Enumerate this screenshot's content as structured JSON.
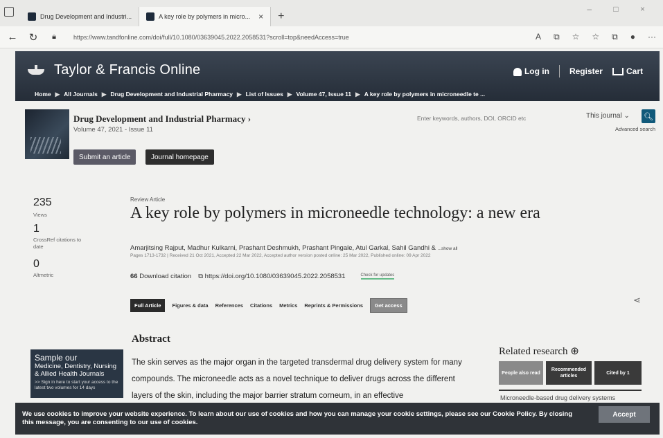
{
  "browser": {
    "tabs": [
      {
        "label": "Drug Development and Industri..."
      },
      {
        "label": "A key role by polymers in micro..."
      }
    ],
    "url": "https://www.tandfonline.com/doi/full/10.1080/03639045.2022.2058531?scroll=top&needAccess=true"
  },
  "header": {
    "logo": "Taylor & Francis Online",
    "login": "Log in",
    "register": "Register",
    "cart": "Cart"
  },
  "breadcrumb": [
    "Home",
    "All Journals",
    "Drug Development and Industrial Pharmacy",
    "List of Issues",
    "Volume 47, Issue 11",
    "A key role by polymers in microneedle te ..."
  ],
  "journal": {
    "title": "Drug Development and Industrial Pharmacy",
    "volume": "Volume 47, 2021 - Issue 11",
    "submit": "Submit an article",
    "homepage": "Journal homepage",
    "search_placeholder": "Enter keywords, authors, DOI, ORCID etc",
    "scope": "This journal",
    "advanced": "Advanced search"
  },
  "metrics": {
    "views": "235",
    "views_label": "Views",
    "crossref": "1",
    "crossref_label": "CrossRef citations to date",
    "altmetric": "0",
    "altmetric_label": "Altmetric"
  },
  "article": {
    "kind": "Review Article",
    "title": "A key role by polymers in microneedle technology: a new era",
    "authors": "Amarjitsing Rajput, Madhur Kulkarni, Prashant Deshmukh, Prashant Pingale, Atul Garkal, Sahil Gandhi &",
    "show_all": "...show all",
    "pubinfo": "Pages 1713-1732 | Received 21 Oct 2021, Accepted 22 Mar 2022, Accepted author version posted online: 25 Mar 2022, Published online: 09 Apr 2022",
    "download_citation": "Download citation",
    "doi": "https://doi.org/10.1080/03639045.2022.2058531",
    "check_updates": "Check for updates"
  },
  "tabs": [
    "Full Article",
    "Figures & data",
    "References",
    "Citations",
    "Metrics",
    "Reprints & Permissions",
    "Get access"
  ],
  "abstract": {
    "heading": "Abstract",
    "text": "The skin serves as the major organ in the targeted transdermal drug delivery system for many compounds. The microneedle acts as a novel technique to deliver drugs across the different layers of the skin, including the major barrier stratum corneum, in an effective"
  },
  "related": {
    "heading": "Related research",
    "tabs": [
      "People also read",
      "Recommended articles",
      "Cited by 1"
    ],
    "first_item": "Microneedle-based drug delivery systems"
  },
  "promo": {
    "line1": "Sample our",
    "line2": "Medicine, Dentistry, Nursing & Allied Health Journals",
    "line3": ">> Sign in here to start your access to the latest two volumes for 14 days"
  },
  "cookie": {
    "text": "We use cookies to improve your website experience. To learn about our use of cookies and how you can manage your cookie settings, please see our Cookie Policy. By closing this message, you are consenting to our use of cookies.",
    "accept": "Accept"
  }
}
